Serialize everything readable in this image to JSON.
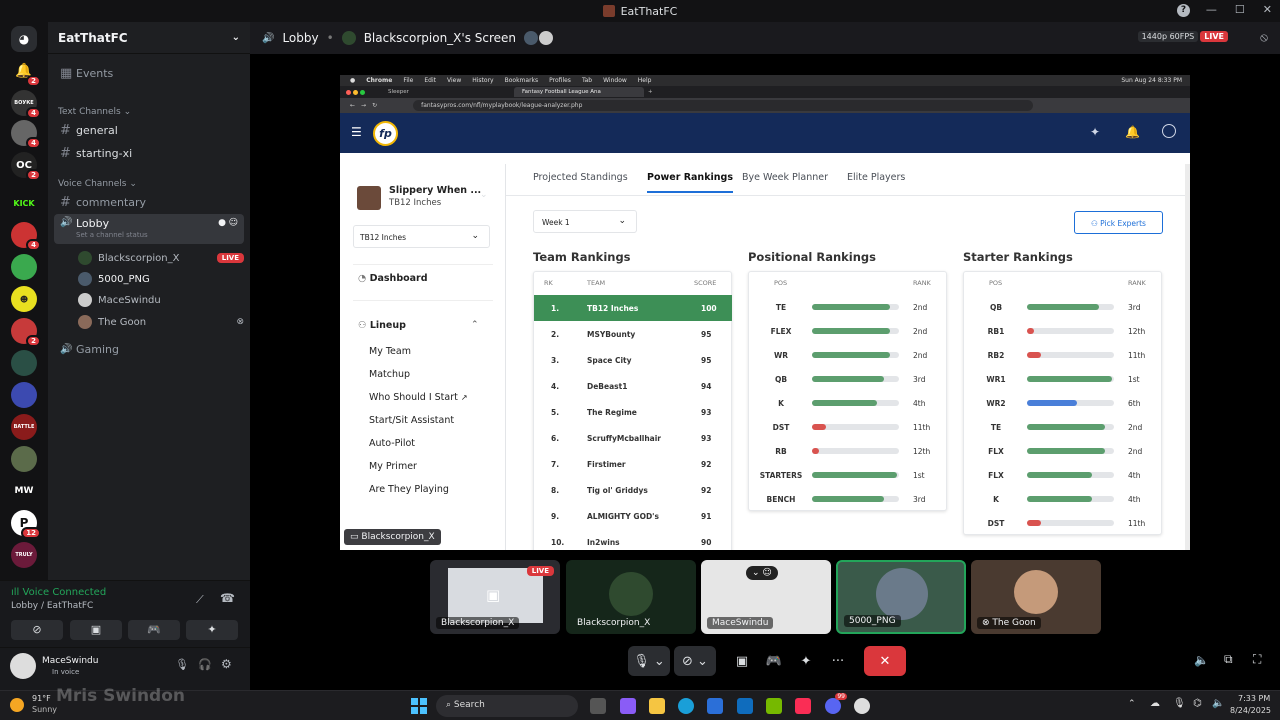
{
  "window": {
    "title": "EatThatFC"
  },
  "server": {
    "name": "EatThatFC",
    "events_label": "Events"
  },
  "rail_badges": [
    "2",
    "4",
    "4",
    "2",
    "4",
    "2",
    "2",
    "12"
  ],
  "rail_labels": {
    "kick": "KICK",
    "mw": "MW"
  },
  "text_channels": {
    "header": "Text Channels",
    "items": [
      "general",
      "starting-xi"
    ]
  },
  "voice_channels": {
    "header": "Voice Channels",
    "commentary": "commentary",
    "lobby": "Lobby",
    "lobby_status": "Set a channel status",
    "gaming": "Gaming",
    "users": [
      {
        "name": "Blackscorpion_X",
        "live": "LIVE"
      },
      {
        "name": "5000_PNG"
      },
      {
        "name": "MaceSwindu"
      },
      {
        "name": "The Goon"
      }
    ]
  },
  "voice_panel": {
    "status": "Voice Connected",
    "location": "Lobby / EatThatFC",
    "user": "MaceSwindu",
    "user_status": "In voice"
  },
  "stream_header": {
    "channel": "Lobby",
    "screen_title": "Blackscorpion_X's Screen",
    "quality": "1440p 60FPS",
    "live": "LIVE"
  },
  "mac": {
    "menu": [
      "Chrome",
      "File",
      "Edit",
      "View",
      "History",
      "Bookmarks",
      "Profiles",
      "Tab",
      "Window",
      "Help"
    ],
    "clock": "Sun Aug 24  8:33 PM",
    "tabs": [
      "Sleeper",
      "Fantasy Football League Ana"
    ],
    "url": "fantasypros.com/nfl/myplaybook/league-analyzer.php"
  },
  "fp": {
    "logo": "fp",
    "team_name": "Slippery When ...",
    "team_sub": "TB12 Inches",
    "team_select": "TB12 Inches",
    "dashboard": "Dashboard",
    "lineup": "Lineup",
    "lineup_items": [
      "My Team",
      "Matchup",
      "Who Should I Start",
      "Start/Sit Assistant",
      "Auto-Pilot",
      "My Primer",
      "Are They Playing"
    ],
    "tabs": [
      "Projected Standings",
      "Power Rankings",
      "Bye Week Planner",
      "Elite Players"
    ],
    "week": "Week 1",
    "pick_experts": "Pick Experts",
    "team_rankings": {
      "title": "Team Rankings",
      "headers": [
        "RK",
        "TEAM",
        "SCORE"
      ],
      "rows": [
        [
          "1.",
          "TB12 Inches",
          "100"
        ],
        [
          "2.",
          "MSYBounty",
          "95"
        ],
        [
          "3.",
          "Space City",
          "95"
        ],
        [
          "4.",
          "DeBeast1",
          "94"
        ],
        [
          "5.",
          "The Regime",
          "93"
        ],
        [
          "6.",
          "ScruffyMcballhair",
          "93"
        ],
        [
          "7.",
          "Firstimer",
          "92"
        ],
        [
          "8.",
          "Tig ol' Griddys",
          "92"
        ],
        [
          "9.",
          "ALMIGHTY GOD's",
          "91"
        ],
        [
          "10.",
          "In2wins",
          "90"
        ]
      ]
    },
    "positional_rankings": {
      "title": "Positional Rankings",
      "headers": [
        "POS",
        "RANK"
      ],
      "rows": [
        {
          "pos": "TE",
          "rank": "2nd",
          "level": 0.9,
          "color": "#5c9e6e"
        },
        {
          "pos": "FLEX",
          "rank": "2nd",
          "level": 0.9,
          "color": "#5c9e6e"
        },
        {
          "pos": "WR",
          "rank": "2nd",
          "level": 0.9,
          "color": "#5c9e6e"
        },
        {
          "pos": "QB",
          "rank": "3rd",
          "level": 0.83,
          "color": "#5c9e6e"
        },
        {
          "pos": "K",
          "rank": "4th",
          "level": 0.75,
          "color": "#5c9e6e"
        },
        {
          "pos": "DST",
          "rank": "11th",
          "level": 0.16,
          "color": "#d9534f"
        },
        {
          "pos": "RB",
          "rank": "12th",
          "level": 0.08,
          "color": "#d9534f"
        },
        {
          "pos": "STARTERS",
          "rank": "1st",
          "level": 0.98,
          "color": "#5c9e6e"
        },
        {
          "pos": "BENCH",
          "rank": "3rd",
          "level": 0.83,
          "color": "#5c9e6e"
        }
      ]
    },
    "starter_rankings": {
      "title": "Starter Rankings",
      "headers": [
        "POS",
        "RANK"
      ],
      "rows": [
        {
          "pos": "QB",
          "rank": "3rd",
          "level": 0.83,
          "color": "#5c9e6e"
        },
        {
          "pos": "RB1",
          "rank": "12th",
          "level": 0.08,
          "color": "#d9534f"
        },
        {
          "pos": "RB2",
          "rank": "11th",
          "level": 0.16,
          "color": "#d9534f"
        },
        {
          "pos": "WR1",
          "rank": "1st",
          "level": 0.98,
          "color": "#5c9e6e"
        },
        {
          "pos": "WR2",
          "rank": "6th",
          "level": 0.58,
          "color": "#4a7fd9"
        },
        {
          "pos": "TE",
          "rank": "2nd",
          "level": 0.9,
          "color": "#5c9e6e"
        },
        {
          "pos": "FLX",
          "rank": "2nd",
          "level": 0.9,
          "color": "#5c9e6e"
        },
        {
          "pos": "FLX",
          "rank": "4th",
          "level": 0.75,
          "color": "#5c9e6e"
        },
        {
          "pos": "K",
          "rank": "4th",
          "level": 0.75,
          "color": "#5c9e6e"
        },
        {
          "pos": "DST",
          "rank": "11th",
          "level": 0.16,
          "color": "#d9534f"
        }
      ]
    }
  },
  "screen_label": "Blackscorpion_X",
  "participants": [
    {
      "name": "Blackscorpion_X",
      "live": "LIVE"
    },
    {
      "name": "Blackscorpion_X"
    },
    {
      "name": "MaceSwindu"
    },
    {
      "name": "5000_PNG"
    },
    {
      "name": "The Goon"
    }
  ],
  "taskbar": {
    "weather_temp": "91°F",
    "weather_desc": "Sunny",
    "ghost_text": "Mris Swindon",
    "search": "Search",
    "time": "7:33 PM",
    "date": "8/24/2025",
    "discord_badge": "99"
  },
  "colors": {
    "live": "#da373c",
    "fp_navy": "#142a59",
    "fp_green": "#3d8f56"
  }
}
